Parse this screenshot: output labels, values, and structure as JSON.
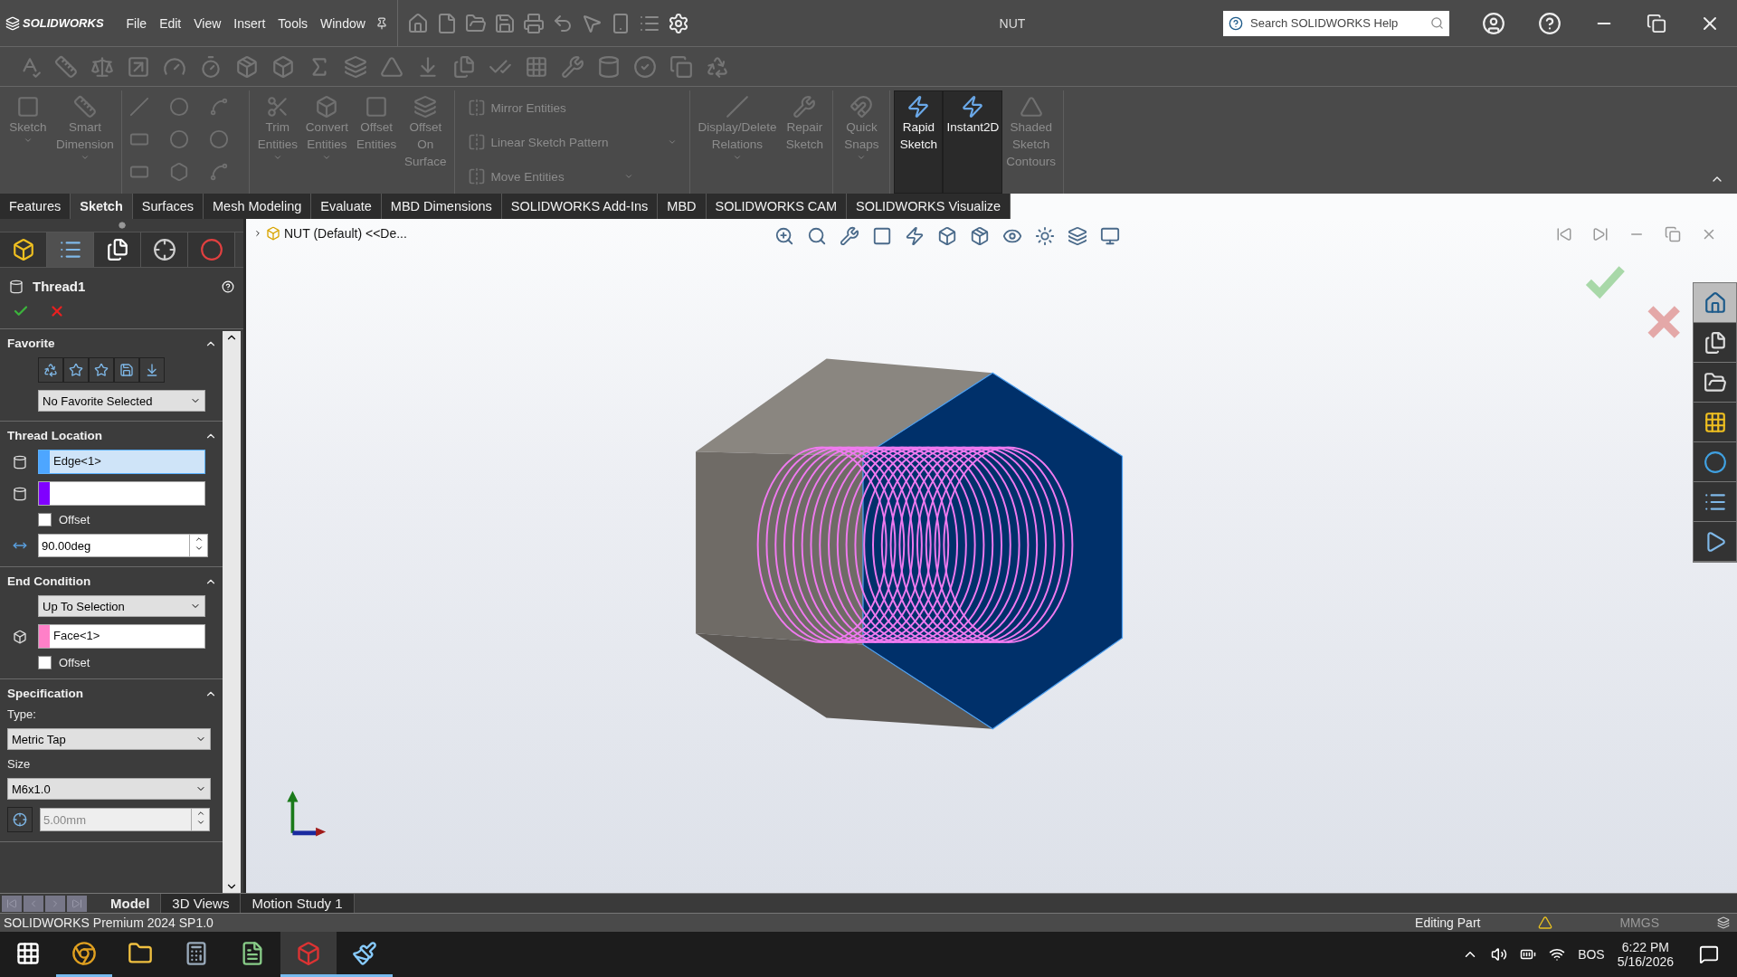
{
  "title_bar": {
    "logo": "SOLIDWORKS",
    "menus": [
      "File",
      "Edit",
      "View",
      "Insert",
      "Tools",
      "Window"
    ],
    "document": "NUT",
    "search": {
      "placeholder": "Search SOLIDWORKS Help"
    }
  },
  "ribbon": {
    "groups": [
      {
        "kind": "tools",
        "tools": [
          {
            "label": "Sketch",
            "active": false,
            "caret": true
          },
          {
            "label": "Smart\nDimension",
            "active": false,
            "caret": true
          }
        ]
      },
      {
        "kind": "entity_grid"
      },
      {
        "kind": "tools",
        "tools": [
          {
            "label": "Trim\nEntities",
            "active": false,
            "caret": true
          },
          {
            "label": "Convert\nEntities",
            "active": false,
            "caret": true
          },
          {
            "label": "Offset\nEntities",
            "active": false,
            "caret": false
          },
          {
            "label": "Offset\nOn\nSurface",
            "active": false,
            "caret": false
          }
        ]
      },
      {
        "kind": "stack",
        "tools": [
          {
            "label": "Mirror Entities",
            "active": false,
            "caret": false
          },
          {
            "label": "Linear Sketch Pattern",
            "active": false,
            "caret": true
          },
          {
            "label": "Move Entities",
            "active": false,
            "caret": true
          }
        ]
      },
      {
        "kind": "tools",
        "tools": [
          {
            "label": "Display/Delete\nRelations",
            "active": false,
            "caret": true
          },
          {
            "label": "Repair\nSketch",
            "active": false,
            "caret": false
          }
        ]
      },
      {
        "kind": "tools",
        "tools": [
          {
            "label": "Quick\nSnaps",
            "active": false,
            "caret": true
          }
        ]
      },
      {
        "kind": "tools",
        "tools": [
          {
            "label": "Rapid\nSketch",
            "active": true,
            "caret": false
          },
          {
            "label": "Instant2D",
            "active": true,
            "caret": false
          },
          {
            "label": "Shaded\nSketch\nContours",
            "active": false,
            "caret": false
          }
        ]
      }
    ]
  },
  "tabs": [
    {
      "label": "Features",
      "selected": false
    },
    {
      "label": "Sketch",
      "selected": true
    },
    {
      "label": "Surfaces",
      "selected": false
    },
    {
      "label": "Mesh Modeling",
      "selected": false
    },
    {
      "label": "Evaluate",
      "selected": false
    },
    {
      "label": "MBD Dimensions",
      "selected": false
    },
    {
      "label": "SOLIDWORKS Add-Ins",
      "selected": false
    },
    {
      "label": "MBD",
      "selected": false
    },
    {
      "label": "SOLIDWORKS CAM",
      "selected": false
    },
    {
      "label": "SOLIDWORKS Visualize",
      "selected": false
    }
  ],
  "property_manager": {
    "manager_tabs": [
      {
        "selected": false
      },
      {
        "selected": true
      },
      {
        "selected": false
      },
      {
        "selected": false
      },
      {
        "selected": false
      }
    ],
    "title": "Thread1",
    "sections": [
      {
        "kind": "favorite",
        "title": "Favorite",
        "expanded": true,
        "dropdown": "No Favorite Selected"
      },
      {
        "kind": "location",
        "title": "Thread Location",
        "expanded": true,
        "selections": [
          {
            "color": "#4da6ff",
            "value": "Edge<1>",
            "active": true
          },
          {
            "color": "#8000ff",
            "active": false
          }
        ],
        "offset": {
          "label": "Offset",
          "checked": false
        },
        "angle": "90.00deg"
      },
      {
        "kind": "end",
        "title": "End Condition",
        "expanded": true,
        "dropdown": "Up To Selection",
        "selections": [
          {
            "color": "#ff80c8",
            "value": "Face<1>",
            "active": false
          }
        ],
        "offset": {
          "label": "Offset",
          "checked": false
        }
      },
      {
        "kind": "spec",
        "title": "Specification",
        "expanded": true,
        "type_label": "Type:",
        "type": "Metric Tap",
        "size_label": "Size",
        "size": "M6x1.0",
        "diameter": "5.00mm"
      }
    ]
  },
  "viewport": {
    "tree_item": "NUT (Default) <<De..."
  },
  "task_pane": [
    {
      "selected": true
    },
    {
      "selected": false
    },
    {
      "selected": false
    },
    {
      "selected": false
    },
    {
      "selected": false
    },
    {
      "selected": false
    },
    {
      "selected": false
    }
  ],
  "bottom_tabs": [
    {
      "label": "Model",
      "selected": true
    },
    {
      "label": "3D Views",
      "selected": false
    },
    {
      "label": "Motion Study 1",
      "selected": false
    }
  ],
  "status_bar": {
    "product": "SOLIDWORKS Premium 2024 SP1.0",
    "mode": "Editing Part",
    "units": "MMGS"
  },
  "taskbar": {
    "apps": [
      {
        "running": false,
        "selected": false
      },
      {
        "running": true,
        "selected": false
      },
      {
        "running": false,
        "selected": false
      },
      {
        "running": false,
        "selected": false
      },
      {
        "running": false,
        "selected": false
      },
      {
        "running": true,
        "selected": true
      },
      {
        "running": true,
        "selected": false
      }
    ],
    "language": "BOS",
    "time": "6:22 PM",
    "date": "5/16/2026"
  }
}
